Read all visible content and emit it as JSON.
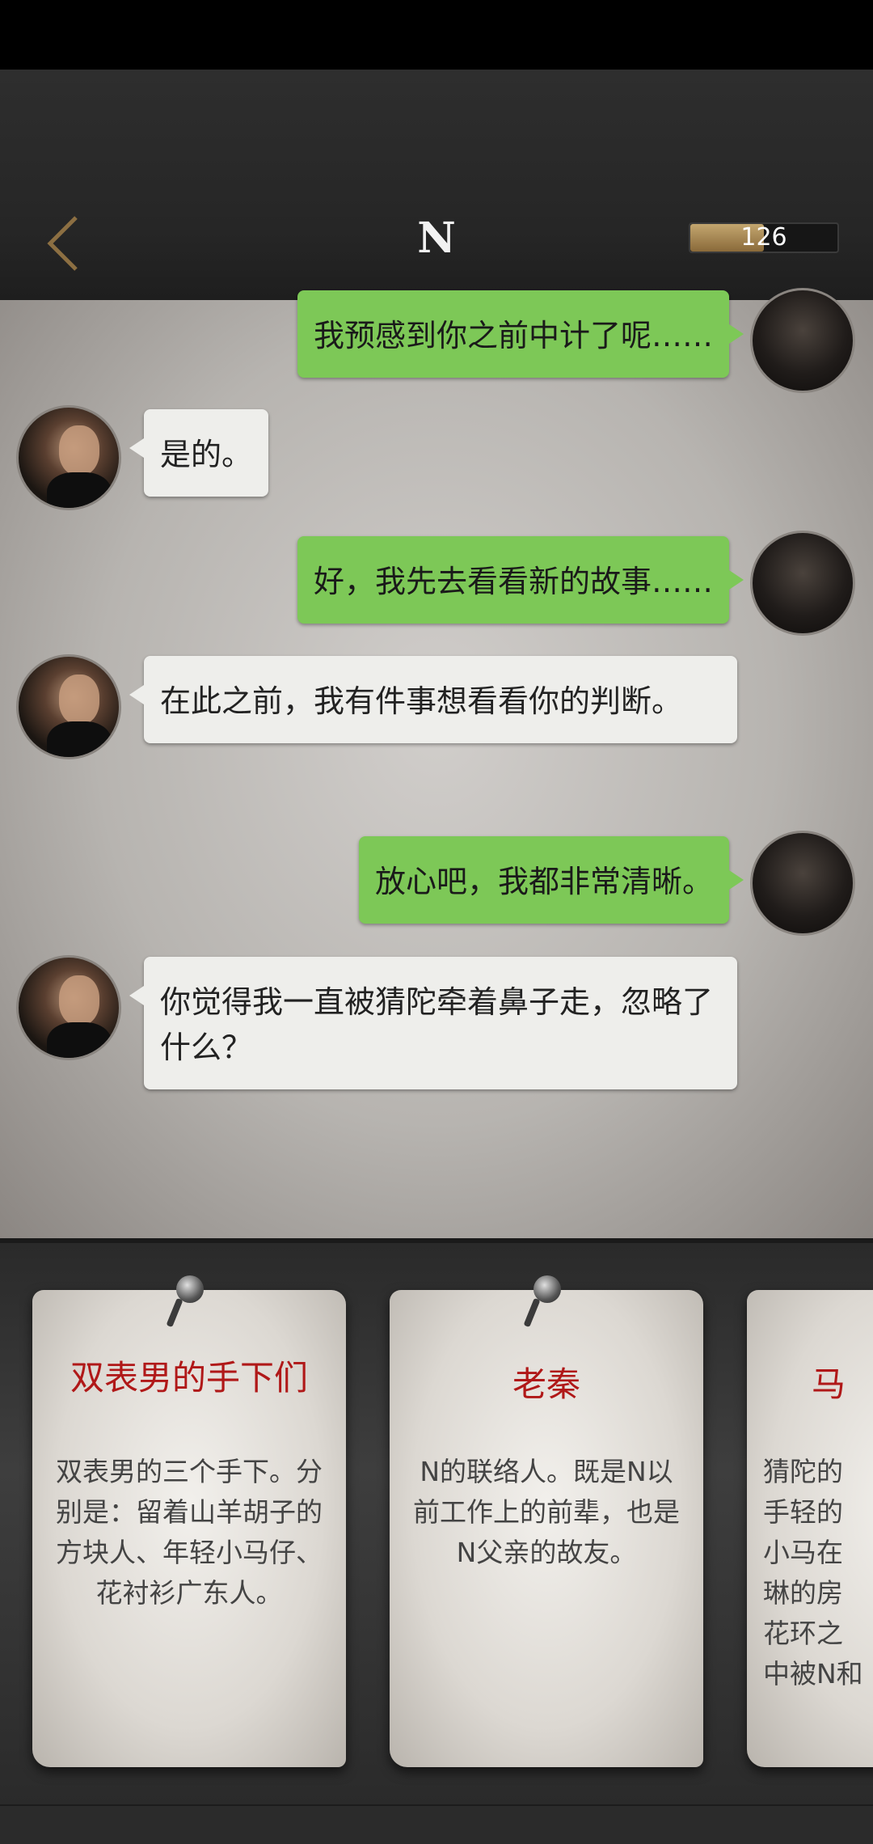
{
  "header": {
    "back_label": "<",
    "title": "N",
    "energy": {
      "value": "126",
      "fill_fraction": 0.5
    }
  },
  "messages": [
    {
      "side": "me",
      "text": "我预感到你之前中计了呢……"
    },
    {
      "side": "them",
      "text": "是的。"
    },
    {
      "side": "me",
      "text": "好，我先去看看新的故事……"
    },
    {
      "side": "them",
      "text": "在此之前，我有件事想看看你的判断。"
    },
    {
      "side": "me",
      "text": "放心吧，我都非常清晰。"
    },
    {
      "side": "them",
      "text": "你觉得我一直被猜陀牵着鼻子走，忽略了什么？"
    }
  ],
  "cards": [
    {
      "title": "双表男的手下们",
      "desc": "双表男的三个手下。分别是：留着山羊胡子的方块人、年轻小马仔、花衬衫广东人。"
    },
    {
      "title": "老秦",
      "desc": "N的联络人。既是N以前工作上的前辈，也是N父亲的故友。"
    },
    {
      "title": "马",
      "desc": "猜陀的手轻的小马在琳的房花环之中被N和"
    }
  ],
  "colors": {
    "my_bubble": "#7dc857",
    "their_bubble": "#eeeeeb",
    "card_title": "#b01818",
    "energy_fill": "#b4955f"
  }
}
